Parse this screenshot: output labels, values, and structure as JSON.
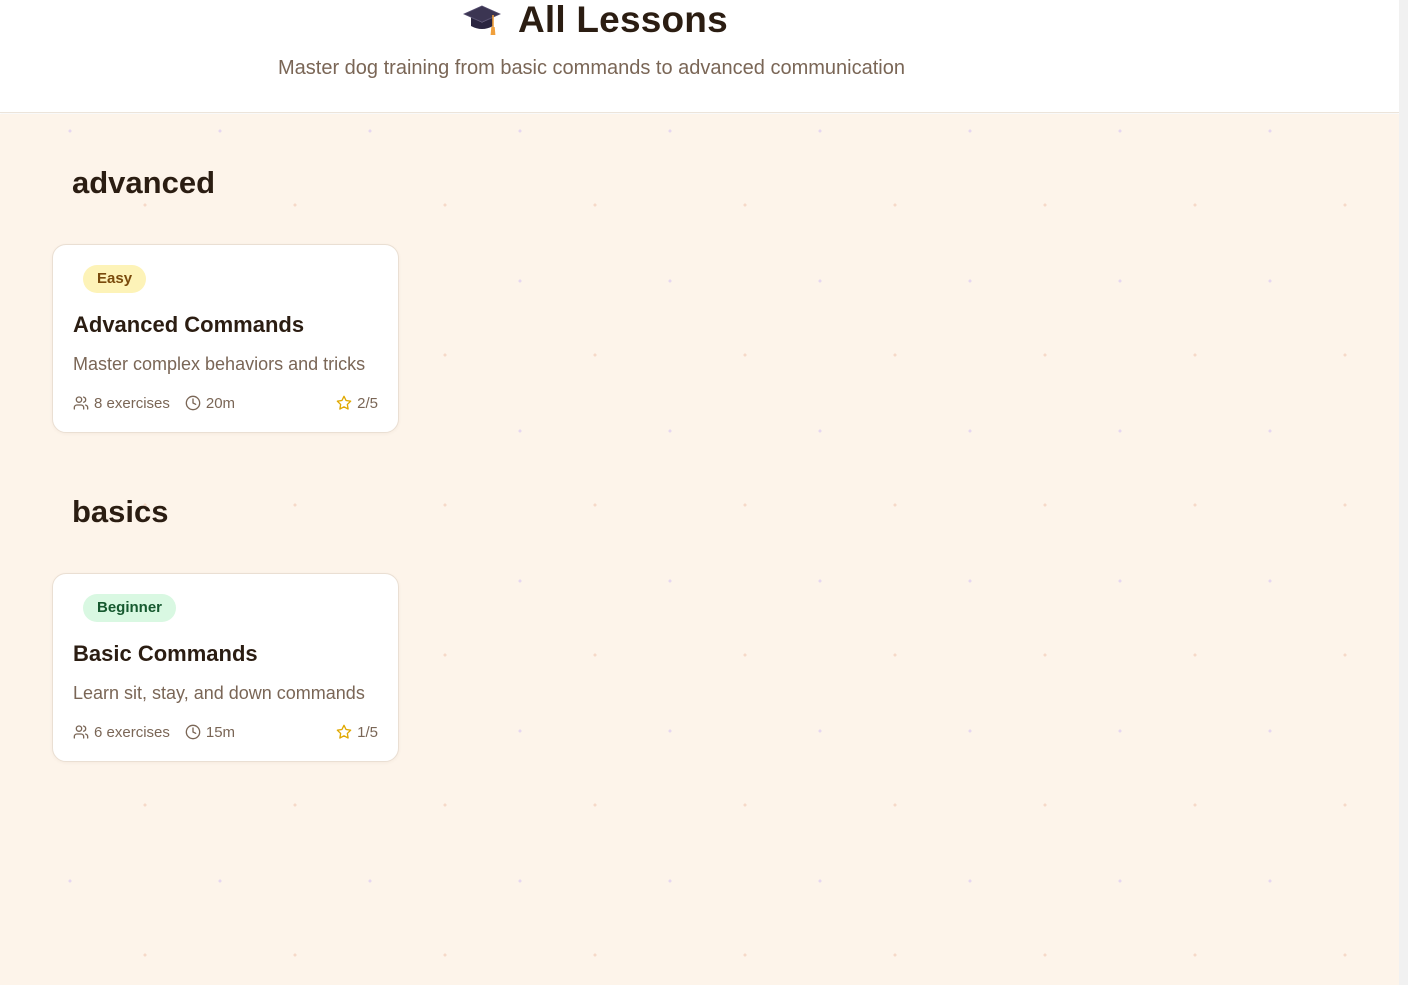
{
  "header": {
    "title": "All Lessons",
    "subtitle": "Master dog training from basic commands to advanced communication",
    "icon": "graduation-cap-icon"
  },
  "sections": [
    {
      "title": "advanced",
      "lessons": [
        {
          "difficulty": "Easy",
          "title": "Advanced Commands",
          "description": "Master complex behaviors and tricks",
          "exercises": "8 exercises",
          "duration": "20m",
          "rating": "2/5"
        }
      ]
    },
    {
      "title": "basics",
      "lessons": [
        {
          "difficulty": "Beginner",
          "title": "Basic Commands",
          "description": "Learn sit, stay, and down commands",
          "exercises": "6 exercises",
          "duration": "15m",
          "rating": "1/5"
        }
      ]
    }
  ],
  "colors": {
    "background": "#fdf4ea",
    "easy_badge": "#fdf3b8",
    "beginner_badge": "#d9f8e2",
    "star": "#e0a800"
  }
}
